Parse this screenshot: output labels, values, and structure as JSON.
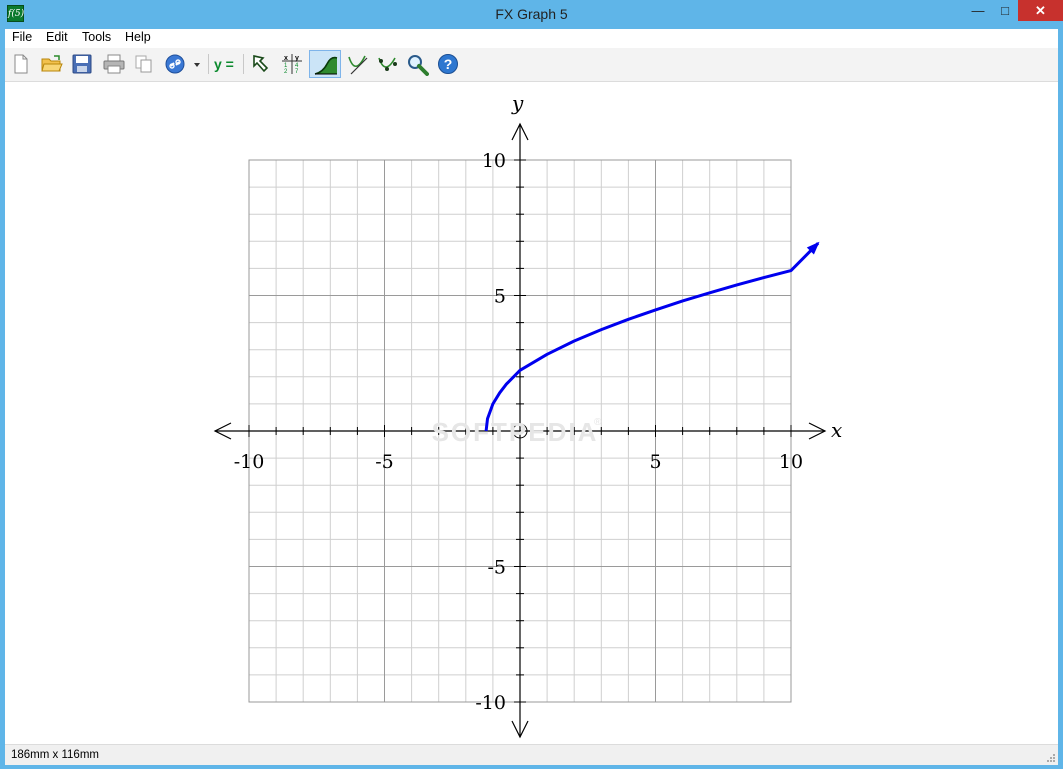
{
  "window": {
    "title": "FX Graph 5",
    "app_icon_label": "f(5)",
    "minimize_label": "—",
    "maximize_label": "□",
    "close_label": "✕"
  },
  "menu": {
    "items": [
      {
        "label": "File",
        "name": "menu-file"
      },
      {
        "label": "Edit",
        "name": "menu-edit"
      },
      {
        "label": "Tools",
        "name": "menu-tools"
      },
      {
        "label": "Help",
        "name": "menu-help"
      }
    ]
  },
  "toolbar": {
    "y_equals_label": "y =",
    "buttons": [
      {
        "name": "new-document-button",
        "icon": "new-document-icon"
      },
      {
        "name": "open-folder-button",
        "icon": "open-folder-icon"
      },
      {
        "name": "save-button",
        "icon": "save-icon"
      },
      {
        "name": "print-button",
        "icon": "printer-icon"
      },
      {
        "name": "copy-button",
        "icon": "copy-icon"
      },
      {
        "name": "link-button",
        "icon": "link-icon"
      },
      {
        "name": "y-equals-button",
        "icon": "y-equals-icon"
      },
      {
        "name": "select-tool-button",
        "icon": "arrow-cursor-icon"
      },
      {
        "name": "table-of-values-button",
        "icon": "xy-table-icon"
      },
      {
        "name": "area-under-curve-button",
        "icon": "area-curve-icon",
        "active": true
      },
      {
        "name": "tangent-tool-button",
        "icon": "tangent-icon"
      },
      {
        "name": "points-tool-button",
        "icon": "points-curve-icon"
      },
      {
        "name": "zoom-button",
        "icon": "magnifier-icon"
      },
      {
        "name": "help-button",
        "icon": "help-icon"
      }
    ],
    "table_icon_header_x": "x",
    "table_icon_header_y": "y",
    "table_icon_values": [
      "1",
      "4",
      "2",
      "7"
    ]
  },
  "graph": {
    "x_axis_label": "x",
    "y_axis_label": "y",
    "x_tick_labels": [
      "-10",
      "-5",
      "5",
      "10"
    ],
    "y_tick_labels": [
      "10",
      "5",
      "-5",
      "-10"
    ],
    "watermark": "SOFTPEDIA",
    "watermark_mark": "®",
    "curve_color": "#0000ee"
  },
  "chart_data": {
    "type": "line",
    "title": "",
    "xlabel": "x",
    "ylabel": "y",
    "xlim": [
      -10,
      10
    ],
    "ylim": [
      -10,
      10
    ],
    "grid": true,
    "x_ticks": [
      -10,
      -5,
      5,
      10
    ],
    "y_ticks": [
      -10,
      -5,
      5,
      10
    ],
    "series": [
      {
        "x": [
          -1.25,
          -1.2,
          -1.0,
          -0.75,
          -0.5,
          0,
          1,
          2,
          3,
          4,
          5,
          6,
          7,
          8,
          9,
          10,
          11
        ],
        "y": [
          0,
          0.45,
          1.0,
          1.41,
          1.73,
          2.24,
          2.83,
          3.32,
          3.74,
          4.12,
          4.47,
          4.8,
          5.1,
          5.39,
          5.66,
          5.92,
          6.93
        ],
        "color": "#0000ee",
        "end_arrow": true
      }
    ]
  },
  "status": {
    "dimensions": "186mm x 116mm"
  }
}
